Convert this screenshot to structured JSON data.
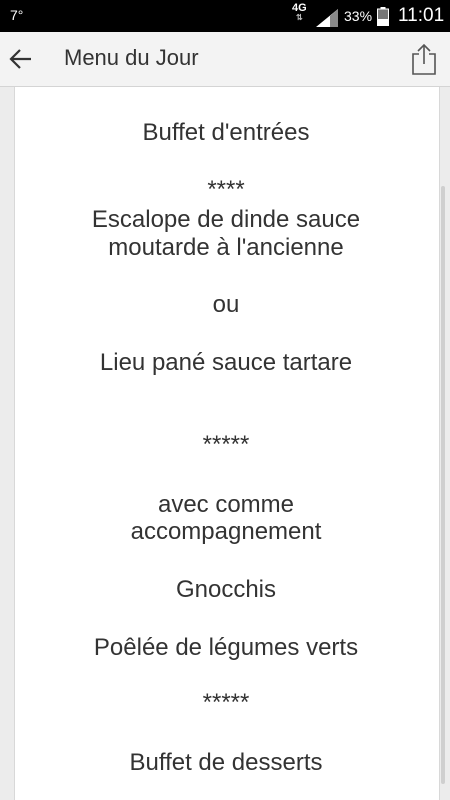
{
  "status_bar": {
    "temperature": "7°",
    "network": "4G",
    "battery_percent": "33%",
    "time": "11:01",
    "icons": [
      "signal-icon",
      "battery-icon"
    ]
  },
  "app_bar": {
    "title": "Menu du Jour",
    "icons": [
      "back-arrow-icon",
      "share-icon"
    ]
  },
  "menu": {
    "starter": "Buffet d'entrées",
    "sep1": "****",
    "main1_line1": "Escalope de dinde sauce",
    "main1_line2": "moutarde à l'ancienne",
    "or": "ou",
    "main2": "Lieu pané sauce tartare",
    "sep2": "*****",
    "side_intro_line1": "avec comme",
    "side_intro_line2": "accompagnement",
    "side1": "Gnocchis",
    "side2": "Poêlée de légumes verts",
    "sep3": "*****",
    "dessert": "Buffet de desserts"
  }
}
